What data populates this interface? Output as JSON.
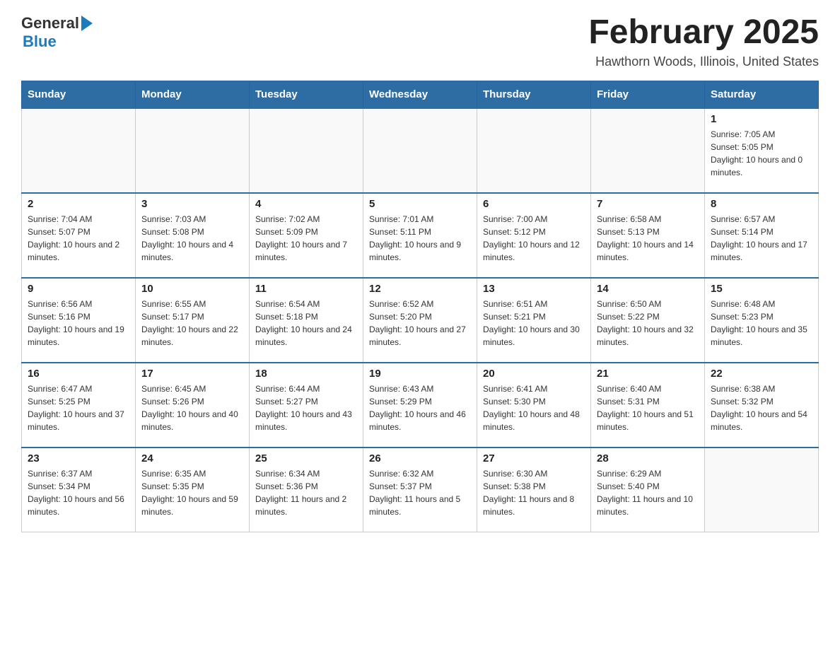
{
  "header": {
    "logo": {
      "general": "General",
      "blue": "Blue",
      "arrow_label": "logo-arrow"
    },
    "title": "February 2025",
    "subtitle": "Hawthorn Woods, Illinois, United States"
  },
  "calendar": {
    "days_of_week": [
      "Sunday",
      "Monday",
      "Tuesday",
      "Wednesday",
      "Thursday",
      "Friday",
      "Saturday"
    ],
    "weeks": [
      [
        {
          "day": "",
          "info": ""
        },
        {
          "day": "",
          "info": ""
        },
        {
          "day": "",
          "info": ""
        },
        {
          "day": "",
          "info": ""
        },
        {
          "day": "",
          "info": ""
        },
        {
          "day": "",
          "info": ""
        },
        {
          "day": "1",
          "info": "Sunrise: 7:05 AM\nSunset: 5:05 PM\nDaylight: 10 hours and 0 minutes."
        }
      ],
      [
        {
          "day": "2",
          "info": "Sunrise: 7:04 AM\nSunset: 5:07 PM\nDaylight: 10 hours and 2 minutes."
        },
        {
          "day": "3",
          "info": "Sunrise: 7:03 AM\nSunset: 5:08 PM\nDaylight: 10 hours and 4 minutes."
        },
        {
          "day": "4",
          "info": "Sunrise: 7:02 AM\nSunset: 5:09 PM\nDaylight: 10 hours and 7 minutes."
        },
        {
          "day": "5",
          "info": "Sunrise: 7:01 AM\nSunset: 5:11 PM\nDaylight: 10 hours and 9 minutes."
        },
        {
          "day": "6",
          "info": "Sunrise: 7:00 AM\nSunset: 5:12 PM\nDaylight: 10 hours and 12 minutes."
        },
        {
          "day": "7",
          "info": "Sunrise: 6:58 AM\nSunset: 5:13 PM\nDaylight: 10 hours and 14 minutes."
        },
        {
          "day": "8",
          "info": "Sunrise: 6:57 AM\nSunset: 5:14 PM\nDaylight: 10 hours and 17 minutes."
        }
      ],
      [
        {
          "day": "9",
          "info": "Sunrise: 6:56 AM\nSunset: 5:16 PM\nDaylight: 10 hours and 19 minutes."
        },
        {
          "day": "10",
          "info": "Sunrise: 6:55 AM\nSunset: 5:17 PM\nDaylight: 10 hours and 22 minutes."
        },
        {
          "day": "11",
          "info": "Sunrise: 6:54 AM\nSunset: 5:18 PM\nDaylight: 10 hours and 24 minutes."
        },
        {
          "day": "12",
          "info": "Sunrise: 6:52 AM\nSunset: 5:20 PM\nDaylight: 10 hours and 27 minutes."
        },
        {
          "day": "13",
          "info": "Sunrise: 6:51 AM\nSunset: 5:21 PM\nDaylight: 10 hours and 30 minutes."
        },
        {
          "day": "14",
          "info": "Sunrise: 6:50 AM\nSunset: 5:22 PM\nDaylight: 10 hours and 32 minutes."
        },
        {
          "day": "15",
          "info": "Sunrise: 6:48 AM\nSunset: 5:23 PM\nDaylight: 10 hours and 35 minutes."
        }
      ],
      [
        {
          "day": "16",
          "info": "Sunrise: 6:47 AM\nSunset: 5:25 PM\nDaylight: 10 hours and 37 minutes."
        },
        {
          "day": "17",
          "info": "Sunrise: 6:45 AM\nSunset: 5:26 PM\nDaylight: 10 hours and 40 minutes."
        },
        {
          "day": "18",
          "info": "Sunrise: 6:44 AM\nSunset: 5:27 PM\nDaylight: 10 hours and 43 minutes."
        },
        {
          "day": "19",
          "info": "Sunrise: 6:43 AM\nSunset: 5:29 PM\nDaylight: 10 hours and 46 minutes."
        },
        {
          "day": "20",
          "info": "Sunrise: 6:41 AM\nSunset: 5:30 PM\nDaylight: 10 hours and 48 minutes."
        },
        {
          "day": "21",
          "info": "Sunrise: 6:40 AM\nSunset: 5:31 PM\nDaylight: 10 hours and 51 minutes."
        },
        {
          "day": "22",
          "info": "Sunrise: 6:38 AM\nSunset: 5:32 PM\nDaylight: 10 hours and 54 minutes."
        }
      ],
      [
        {
          "day": "23",
          "info": "Sunrise: 6:37 AM\nSunset: 5:34 PM\nDaylight: 10 hours and 56 minutes."
        },
        {
          "day": "24",
          "info": "Sunrise: 6:35 AM\nSunset: 5:35 PM\nDaylight: 10 hours and 59 minutes."
        },
        {
          "day": "25",
          "info": "Sunrise: 6:34 AM\nSunset: 5:36 PM\nDaylight: 11 hours and 2 minutes."
        },
        {
          "day": "26",
          "info": "Sunrise: 6:32 AM\nSunset: 5:37 PM\nDaylight: 11 hours and 5 minutes."
        },
        {
          "day": "27",
          "info": "Sunrise: 6:30 AM\nSunset: 5:38 PM\nDaylight: 11 hours and 8 minutes."
        },
        {
          "day": "28",
          "info": "Sunrise: 6:29 AM\nSunset: 5:40 PM\nDaylight: 11 hours and 10 minutes."
        },
        {
          "day": "",
          "info": ""
        }
      ]
    ]
  }
}
